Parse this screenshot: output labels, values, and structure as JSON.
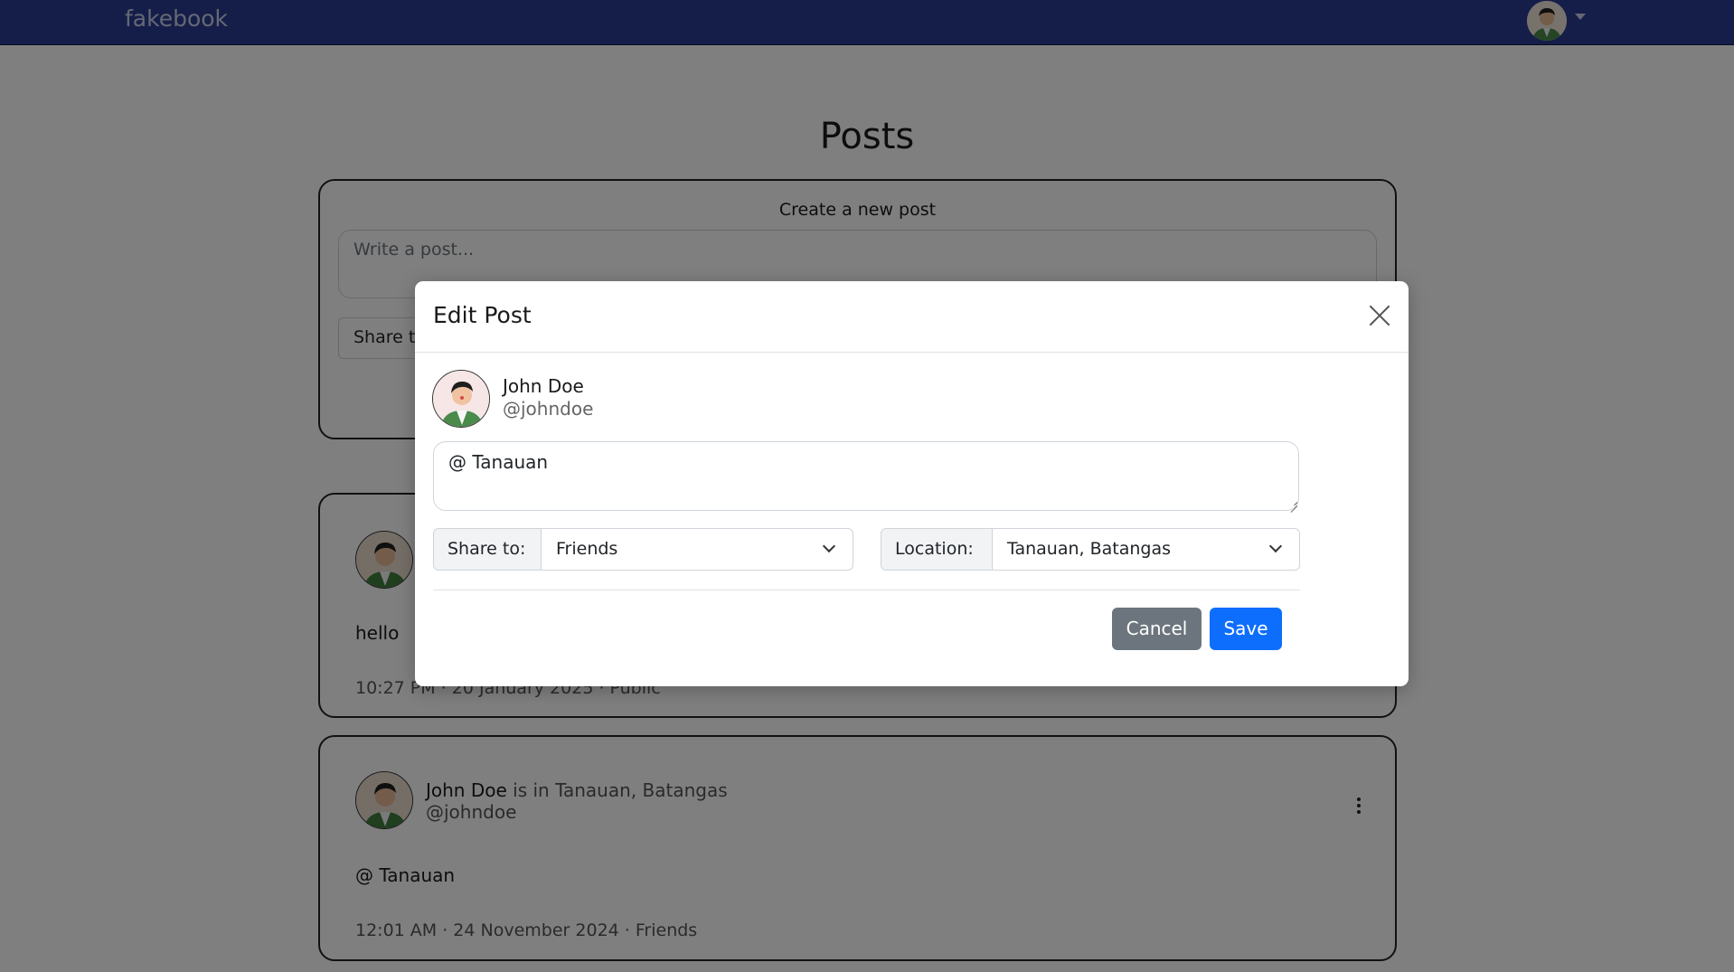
{
  "navbar": {
    "brand": "fakebook",
    "avatar_icon": "user-avatar-icon",
    "caret_icon": "caret-down-icon",
    "bg_color": "#2a3c93"
  },
  "page": {
    "title": "Posts"
  },
  "create_post": {
    "title": "Create a new post",
    "placeholder": "Write a post...",
    "share_label": "Share t"
  },
  "posts": [
    {
      "text": "hello",
      "meta": "10:27 PM · 20 January 2025 · Public"
    },
    {
      "author": "John Doe",
      "location_text": "is in Tanauan, Batangas",
      "handle": "@johndoe",
      "text": "@ Tanauan",
      "meta": "12:01 AM · 24 November 2024 · Friends"
    }
  ],
  "modal": {
    "title": "Edit Post",
    "user_name": "John Doe",
    "user_handle": "@johndoe",
    "post_text": "@ Tanauan",
    "share_label": "Share to:",
    "share_value": "Friends",
    "location_label": "Location:",
    "location_value": "Tanauan, Batangas",
    "cancel_label": "Cancel",
    "save_label": "Save",
    "cancel_color": "#6c757d",
    "save_color": "#0d6efd"
  }
}
